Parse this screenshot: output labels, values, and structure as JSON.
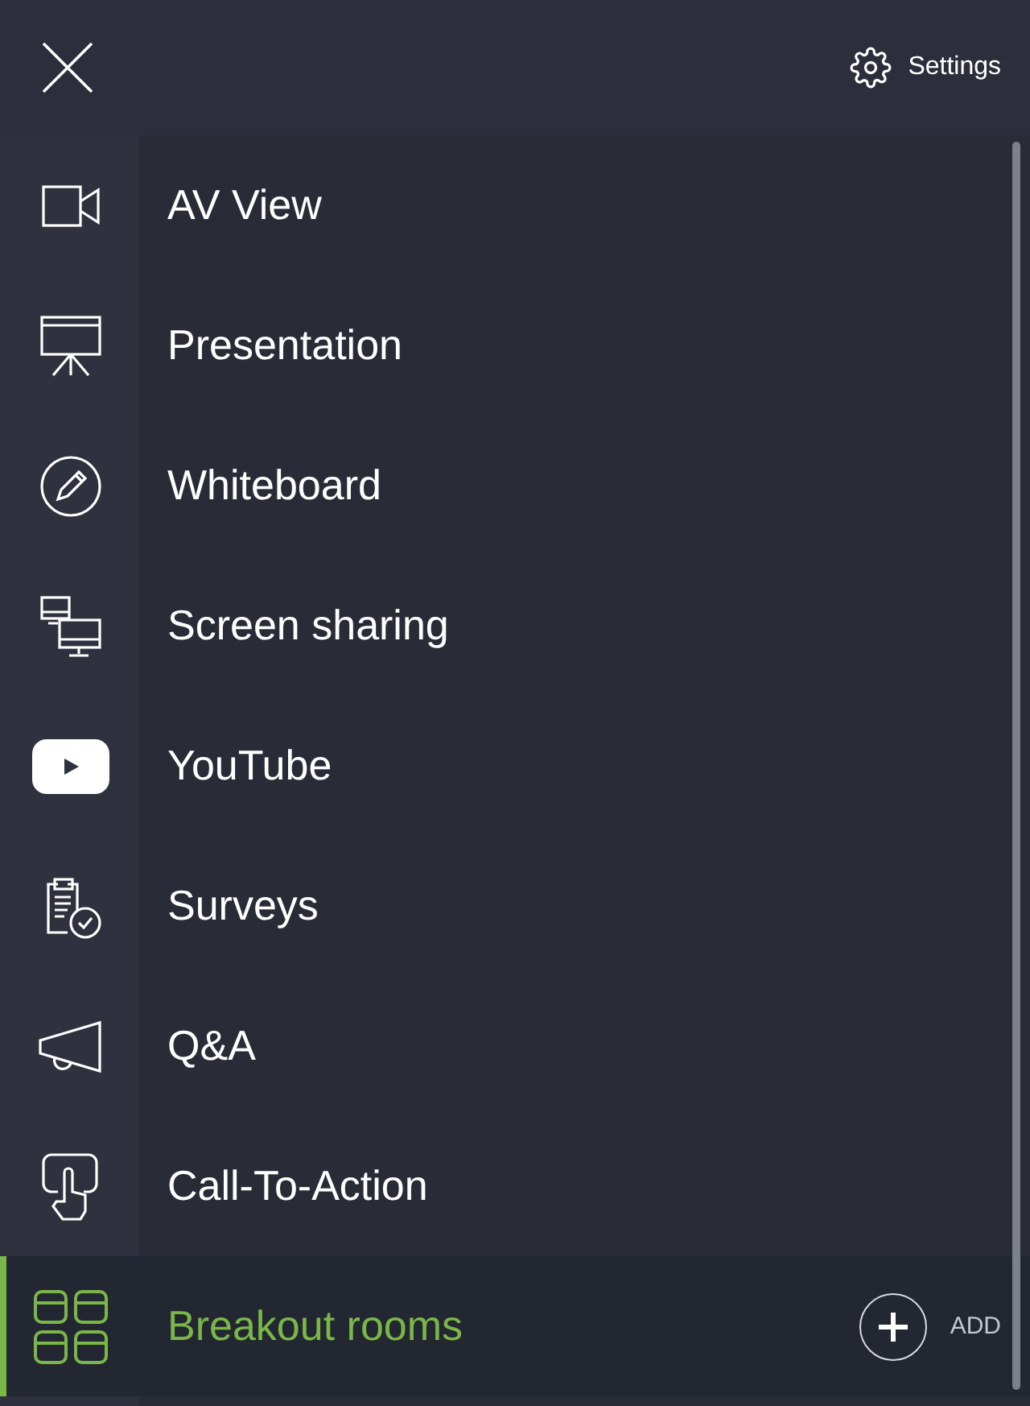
{
  "header": {
    "settings_label": "Settings"
  },
  "menu": [
    {
      "label": "AV View",
      "kind": "camera",
      "selected": false
    },
    {
      "label": "Presentation",
      "kind": "easel",
      "selected": false
    },
    {
      "label": "Whiteboard",
      "kind": "pencil",
      "selected": false
    },
    {
      "label": "Screen sharing",
      "kind": "monitors",
      "selected": false
    },
    {
      "label": "YouTube",
      "kind": "play",
      "selected": false
    },
    {
      "label": "Surveys",
      "kind": "clipboard",
      "selected": false
    },
    {
      "label": "Q&A",
      "kind": "megaphone",
      "selected": false
    },
    {
      "label": "Call-To-Action",
      "kind": "touch",
      "selected": false
    },
    {
      "label": "Breakout rooms",
      "kind": "grid",
      "selected": true,
      "action": "ADD"
    }
  ]
}
